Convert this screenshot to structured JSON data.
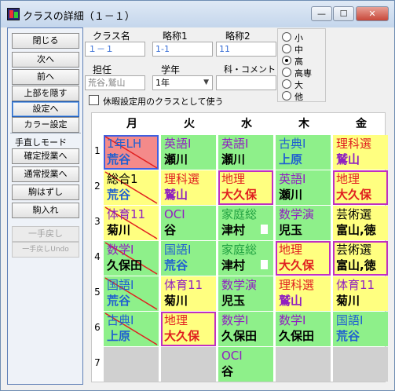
{
  "window": {
    "title": "クラスの詳細（１－１）",
    "min_glyph": "—",
    "max_glyph": "☐",
    "close_glyph": "✕"
  },
  "left_buttons": {
    "close": "閉じる",
    "next": "次へ",
    "prev": "前へ",
    "hide_top": "上部を隠す",
    "settings_next": "設定へ",
    "color_settings": "カラー設定"
  },
  "manual_mode": {
    "label": "手直しモード",
    "confirm": "確定授業へ",
    "normal": "通常授業へ",
    "remove_piece": "駒はずし",
    "insert_piece": "駒入れ",
    "undo": "一手戻し",
    "undo_redo": "一手戻しUndo"
  },
  "form": {
    "class_name_label": "クラス名",
    "class_name_value": "１－１",
    "short1_label": "略称1",
    "short1_value": "1-1",
    "short2_label": "略称2",
    "short2_value": "11",
    "teacher_label": "担任",
    "teacher_value": "荒谷,鷲山",
    "grade_label": "学年",
    "grade_value": "1年",
    "subject_comment_label": "科・コメント",
    "subject_comment_value": "",
    "holiday_checkbox_label": "休暇設定用のクラスとして使う"
  },
  "school_type": {
    "options": [
      "小",
      "中",
      "高",
      "高専",
      "大",
      "他"
    ],
    "selected": "高"
  },
  "timetable": {
    "days": [
      "月",
      "火",
      "水",
      "木",
      "金"
    ],
    "periods": [
      "1",
      "2",
      "3",
      "4",
      "5",
      "6",
      "7"
    ],
    "colors": {
      "green": "#8ef08a",
      "yellow": "#ffff80",
      "red": "#f48a8a",
      "gray": "#d0d0d0",
      "text_blue": "#2060d0",
      "text_red": "#e02020",
      "text_purple": "#9020c0",
      "text_green": "#20a040",
      "text_dark": "#000000"
    },
    "rows": [
      [
        {
          "subject": "1年LH",
          "teacher": "荒谷",
          "bg": "red",
          "c1": "text_blue",
          "c2": "text_blue",
          "slash": true,
          "box": false,
          "sel": true,
          "tag": false
        },
        {
          "subject": "英語Ⅰ",
          "teacher": "瀬川",
          "bg": "green",
          "c1": "text_purple",
          "c2": "text_dark",
          "slash": false,
          "box": false,
          "sel": false,
          "tag": false
        },
        {
          "subject": "英語Ⅰ",
          "teacher": "瀬川",
          "bg": "green",
          "c1": "text_purple",
          "c2": "text_dark",
          "slash": false,
          "box": false,
          "sel": false,
          "tag": false
        },
        {
          "subject": "古典Ⅰ",
          "teacher": "上原",
          "bg": "green",
          "c1": "text_blue",
          "c2": "text_blue",
          "slash": false,
          "box": false,
          "sel": false,
          "tag": false
        },
        {
          "subject": "理科選",
          "teacher": "鷲山",
          "bg": "yellow",
          "c1": "text_red",
          "c2": "text_purple",
          "slash": false,
          "box": false,
          "sel": false,
          "tag": false
        }
      ],
      [
        {
          "subject": "総合1",
          "teacher": "荒谷",
          "bg": "yellow",
          "c1": "text_dark",
          "c2": "text_blue",
          "slash": true,
          "box": false,
          "sel": false,
          "tag": false
        },
        {
          "subject": "理科選",
          "teacher": "鷲山",
          "bg": "yellow",
          "c1": "text_red",
          "c2": "text_purple",
          "slash": false,
          "box": false,
          "sel": false,
          "tag": false
        },
        {
          "subject": "地理",
          "teacher": "大久保",
          "bg": "yellow",
          "c1": "text_red",
          "c2": "text_red",
          "slash": false,
          "box": true,
          "sel": false,
          "tag": false
        },
        {
          "subject": "英語Ⅰ",
          "teacher": "瀬川",
          "bg": "green",
          "c1": "text_purple",
          "c2": "text_dark",
          "slash": false,
          "box": false,
          "sel": false,
          "tag": false
        },
        {
          "subject": "地理",
          "teacher": "大久保",
          "bg": "yellow",
          "c1": "text_red",
          "c2": "text_red",
          "slash": false,
          "box": true,
          "sel": false,
          "tag": false
        }
      ],
      [
        {
          "subject": "体育11",
          "teacher": "菊川",
          "bg": "yellow",
          "c1": "text_purple",
          "c2": "text_dark",
          "slash": true,
          "box": false,
          "sel": false,
          "tag": false
        },
        {
          "subject": "OCⅠ",
          "teacher": "谷",
          "bg": "green",
          "c1": "text_purple",
          "c2": "text_dark",
          "slash": false,
          "box": false,
          "sel": false,
          "tag": false
        },
        {
          "subject": "家庭総",
          "teacher": "津村",
          "bg": "green",
          "c1": "text_green",
          "c2": "text_dark",
          "slash": false,
          "box": false,
          "sel": false,
          "tag": true
        },
        {
          "subject": "数学演",
          "teacher": "児玉",
          "bg": "green",
          "c1": "text_purple",
          "c2": "text_dark",
          "slash": false,
          "box": false,
          "sel": false,
          "tag": false
        },
        {
          "subject": "芸術選",
          "teacher": "富山,徳",
          "bg": "yellow",
          "c1": "text_dark",
          "c2": "text_dark",
          "slash": false,
          "box": false,
          "sel": false,
          "tag": false
        }
      ],
      [
        {
          "subject": "数学Ⅰ",
          "teacher": "久保田",
          "bg": "green",
          "c1": "text_purple",
          "c2": "text_dark",
          "slash": true,
          "box": false,
          "sel": false,
          "tag": false
        },
        {
          "subject": "国語Ⅰ",
          "teacher": "荒谷",
          "bg": "green",
          "c1": "text_blue",
          "c2": "text_blue",
          "slash": false,
          "box": false,
          "sel": false,
          "tag": false
        },
        {
          "subject": "家庭総",
          "teacher": "津村",
          "bg": "green",
          "c1": "text_green",
          "c2": "text_dark",
          "slash": false,
          "box": false,
          "sel": false,
          "tag": true
        },
        {
          "subject": "地理",
          "teacher": "大久保",
          "bg": "yellow",
          "c1": "text_red",
          "c2": "text_red",
          "slash": false,
          "box": true,
          "sel": false,
          "tag": false
        },
        {
          "subject": "芸術選",
          "teacher": "富山,徳",
          "bg": "yellow",
          "c1": "text_dark",
          "c2": "text_dark",
          "slash": false,
          "box": true,
          "sel": false,
          "tag": false
        }
      ],
      [
        {
          "subject": "国語Ⅰ",
          "teacher": "荒谷",
          "bg": "green",
          "c1": "text_blue",
          "c2": "text_blue",
          "slash": true,
          "box": false,
          "sel": false,
          "tag": false
        },
        {
          "subject": "体育11",
          "teacher": "菊川",
          "bg": "yellow",
          "c1": "text_purple",
          "c2": "text_dark",
          "slash": false,
          "box": false,
          "sel": false,
          "tag": false
        },
        {
          "subject": "数学演",
          "teacher": "児玉",
          "bg": "green",
          "c1": "text_purple",
          "c2": "text_dark",
          "slash": false,
          "box": false,
          "sel": false,
          "tag": false
        },
        {
          "subject": "理科選",
          "teacher": "鷲山",
          "bg": "yellow",
          "c1": "text_red",
          "c2": "text_purple",
          "slash": false,
          "box": false,
          "sel": false,
          "tag": false
        },
        {
          "subject": "体育11",
          "teacher": "菊川",
          "bg": "yellow",
          "c1": "text_purple",
          "c2": "text_dark",
          "slash": false,
          "box": false,
          "sel": false,
          "tag": false
        }
      ],
      [
        {
          "subject": "古典Ⅰ",
          "teacher": "上原",
          "bg": "green",
          "c1": "text_blue",
          "c2": "text_blue",
          "slash": true,
          "box": false,
          "sel": false,
          "tag": false
        },
        {
          "subject": "地理",
          "teacher": "大久保",
          "bg": "yellow",
          "c1": "text_red",
          "c2": "text_red",
          "slash": false,
          "box": true,
          "sel": false,
          "tag": false
        },
        {
          "subject": "数学Ⅰ",
          "teacher": "久保田",
          "bg": "green",
          "c1": "text_purple",
          "c2": "text_dark",
          "slash": false,
          "box": false,
          "sel": false,
          "tag": false
        },
        {
          "subject": "数学Ⅰ",
          "teacher": "久保田",
          "bg": "green",
          "c1": "text_purple",
          "c2": "text_dark",
          "slash": false,
          "box": false,
          "sel": false,
          "tag": false
        },
        {
          "subject": "国語Ⅰ",
          "teacher": "荒谷",
          "bg": "green",
          "c1": "text_blue",
          "c2": "text_blue",
          "slash": false,
          "box": false,
          "sel": false,
          "tag": false
        }
      ],
      [
        {
          "subject": "",
          "teacher": "",
          "bg": "gray",
          "c1": "text_dark",
          "c2": "text_dark",
          "slash": false,
          "box": false,
          "sel": false,
          "tag": false
        },
        {
          "subject": "",
          "teacher": "",
          "bg": "gray",
          "c1": "text_dark",
          "c2": "text_dark",
          "slash": false,
          "box": false,
          "sel": false,
          "tag": false
        },
        {
          "subject": "OCⅠ",
          "teacher": "谷",
          "bg": "green",
          "c1": "text_purple",
          "c2": "text_dark",
          "slash": false,
          "box": false,
          "sel": false,
          "tag": false
        },
        {
          "subject": "",
          "teacher": "",
          "bg": "gray",
          "c1": "text_dark",
          "c2": "text_dark",
          "slash": false,
          "box": false,
          "sel": false,
          "tag": false
        },
        {
          "subject": "",
          "teacher": "",
          "bg": "gray",
          "c1": "text_dark",
          "c2": "text_dark",
          "slash": false,
          "box": false,
          "sel": false,
          "tag": false
        }
      ]
    ]
  }
}
